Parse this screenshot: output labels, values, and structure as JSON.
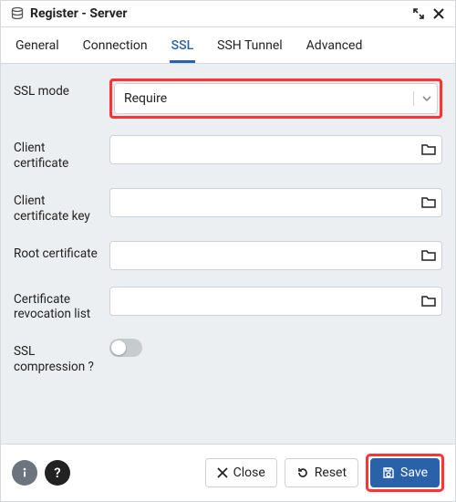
{
  "window": {
    "title": "Register - Server"
  },
  "tabs": {
    "general": "General",
    "connection": "Connection",
    "ssl": "SSL",
    "ssh_tunnel": "SSH Tunnel",
    "advanced": "Advanced",
    "active": "ssl"
  },
  "form": {
    "ssl_mode_label": "SSL mode",
    "ssl_mode_value": "Require",
    "client_cert_label": "Client certificate",
    "client_cert_value": "",
    "client_cert_key_label": "Client certificate key",
    "client_cert_key_value": "",
    "root_cert_label": "Root certificate",
    "root_cert_value": "",
    "crl_label": "Certificate revocation list",
    "crl_value": "",
    "ssl_compression_label": "SSL compression ?",
    "ssl_compression_on": false
  },
  "footer": {
    "close": "Close",
    "reset": "Reset",
    "save": "Save"
  }
}
